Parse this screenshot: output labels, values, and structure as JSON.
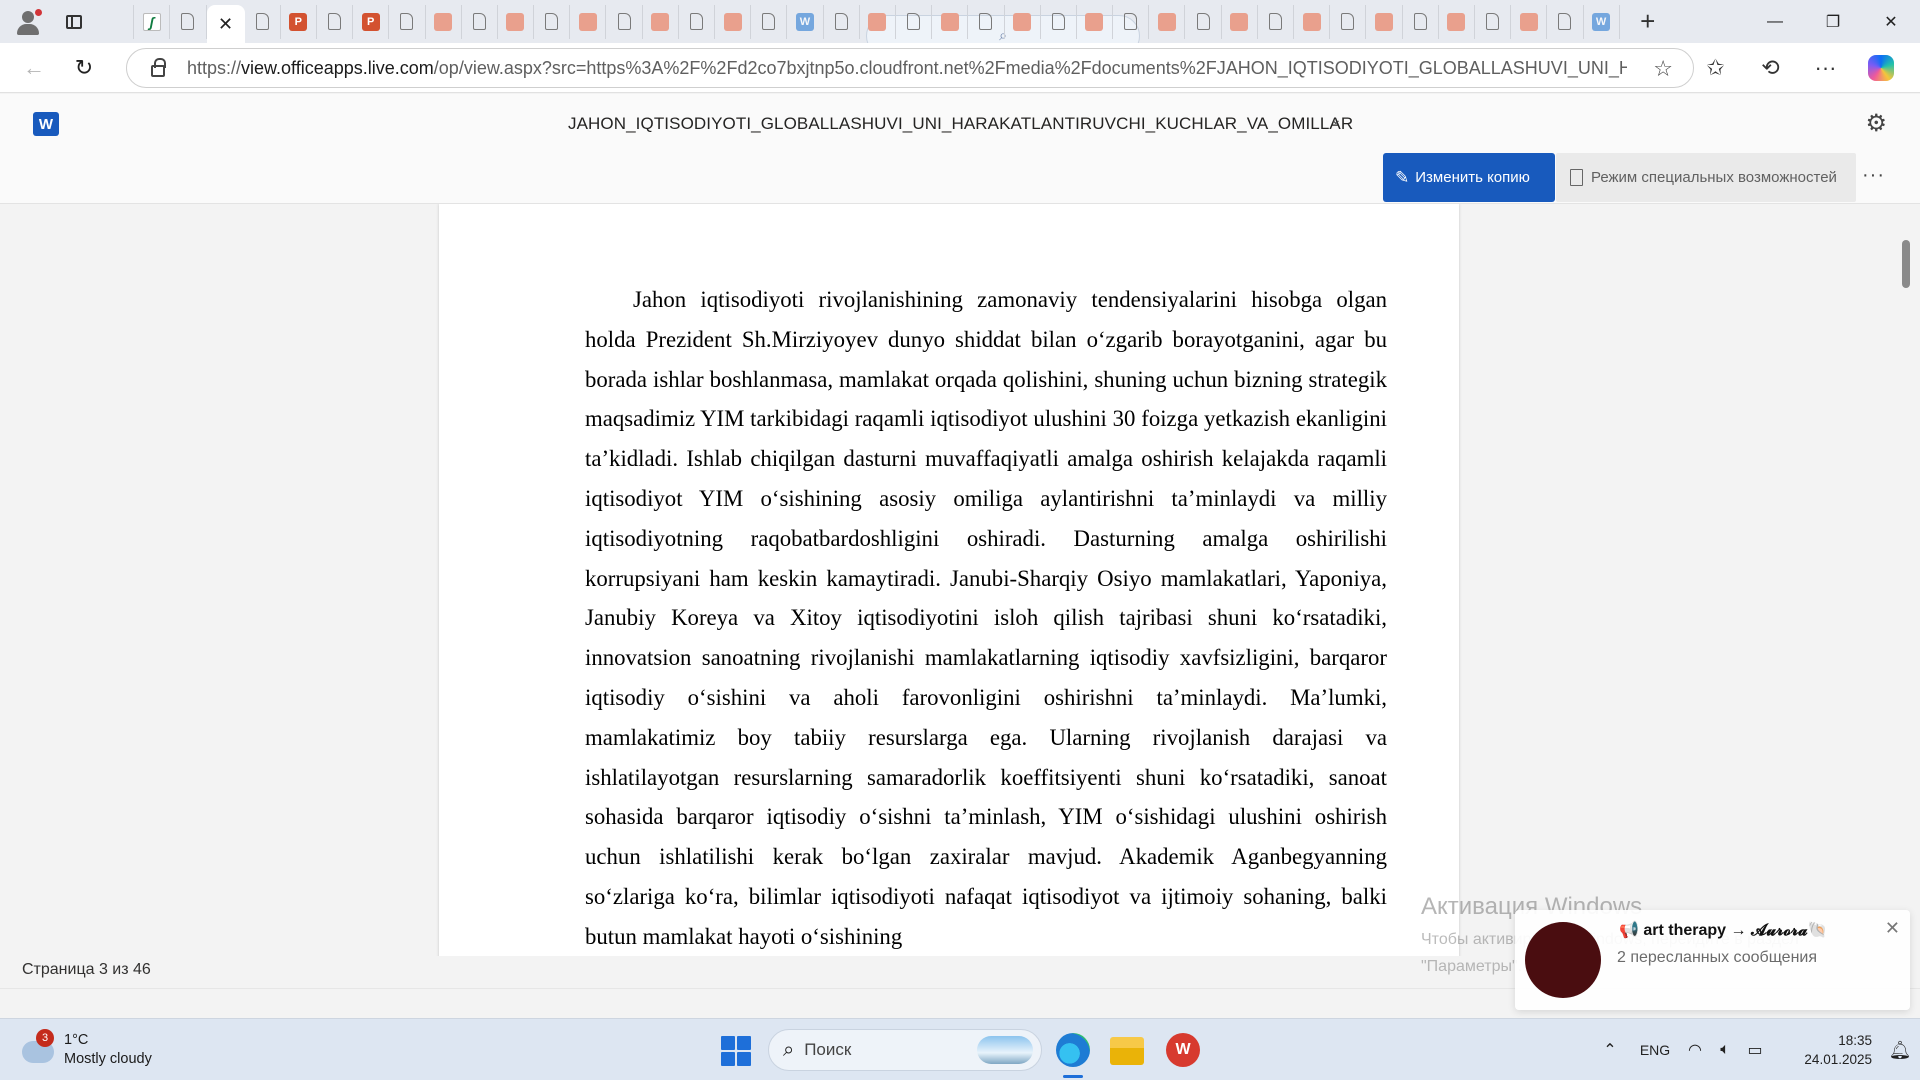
{
  "browser": {
    "tabs": [
      {
        "icon": "search-icon"
      },
      {
        "icon": "sheets-icon"
      },
      {
        "icon": "document-icon"
      },
      {
        "icon": "close-icon",
        "active": true
      },
      {
        "icon": "document-icon"
      },
      {
        "icon": "powerpoint-icon"
      },
      {
        "icon": "document-icon"
      },
      {
        "icon": "powerpoint-icon"
      },
      {
        "icon": "document-icon"
      },
      {
        "icon": "powerpoint-faded-icon"
      },
      {
        "icon": "document-icon"
      },
      {
        "icon": "powerpoint-faded-icon"
      },
      {
        "icon": "document-icon"
      },
      {
        "icon": "powerpoint-faded-icon"
      },
      {
        "icon": "document-icon"
      },
      {
        "icon": "powerpoint-faded-icon"
      },
      {
        "icon": "document-icon"
      },
      {
        "icon": "powerpoint-faded-icon"
      },
      {
        "icon": "document-icon"
      },
      {
        "icon": "word-icon"
      },
      {
        "icon": "document-icon"
      },
      {
        "icon": "powerpoint-faded-icon"
      },
      {
        "icon": "document-icon"
      },
      {
        "icon": "powerpoint-faded-icon"
      },
      {
        "icon": "document-icon"
      },
      {
        "icon": "powerpoint-faded-icon"
      },
      {
        "icon": "document-icon"
      },
      {
        "icon": "powerpoint-faded-icon"
      },
      {
        "icon": "document-icon"
      },
      {
        "icon": "powerpoint-faded-icon"
      },
      {
        "icon": "document-icon"
      },
      {
        "icon": "powerpoint-faded-icon"
      },
      {
        "icon": "document-icon"
      },
      {
        "icon": "powerpoint-faded-icon"
      },
      {
        "icon": "document-icon"
      },
      {
        "icon": "powerpoint-faded-icon"
      },
      {
        "icon": "document-icon"
      },
      {
        "icon": "powerpoint-faded-icon"
      },
      {
        "icon": "document-icon"
      },
      {
        "icon": "powerpoint-faded-icon"
      },
      {
        "icon": "document-icon"
      },
      {
        "icon": "word-icon"
      }
    ],
    "url_host": "https://view.officeapps.live.com",
    "url_path": "/op/view.aspx?src=https%3A%2F%2Fd2co7bxjtnp5o.cloudfront.net%2Fmedia%2Fdocuments%2FJAHON_IQTISODIYOTI_GLOBALLASHUVI_UNI_HARAKATL...",
    "url_host_display": "view.officeapps.live.com"
  },
  "word": {
    "logo_letter": "W",
    "title": "JAHON_IQTISODIYOTI_GLOBALLASHUVI_UNI_HARAKATLANTIRUVCHI_KUCHLAR_VA_OMILLAR",
    "edit_copy_label": "Изменить копию",
    "accessibility_label": "Режим специальных возможностей",
    "paragraph": "Jahon iqtisodiyoti rivojlanishining zamonaviy tendensiyalarini hisobga olgan holda Prezident Sh.Mirziyoyev dunyo shiddat bilan o‘zgarib borayotganini, agar bu borada ishlar boshlanmasa, mamlakat orqada qolishini, shuning uchun bizning strategik maqsadimiz YIM tarkibidagi raqamli iqtisodiyot ulushini 30 foizga yetkazish ekanligini ta’kidladi. Ishlab chiqilgan dasturni muvaffaqiyatli amalga oshirish kelajakda raqamli iqtisodiyot YIM o‘sishining asosiy omiliga aylantirishni ta’minlaydi va milliy iqtisodiyotning raqobatbardoshligini oshiradi. Dasturning amalga oshirilishi korrupsiyani ham keskin kamaytiradi. Janubi-Sharqiy Osiyo mamlakatlari, Yaponiya, Janubiy Koreya va Xitoy iqtisodiyotini isloh qilish tajribasi shuni ko‘rsatadiki, innovatsion sanoatning rivojlanishi mamlakatlarning iqtisodiy xavfsizligini, barqaror iqtisodiy o‘sishini va aholi farovonligini oshirishni ta’minlaydi. Ma’lumki, mamlakatimiz boy tabiiy resurslarga ega. Ularning rivojlanish darajasi va ishlatilayotgan resurslarning samaradorlik koeffitsiyenti shuni ko‘rsatadiki, sanoat sohasida barqaror iqtisodiy o‘sishni ta’minlash, YIM o‘sishidagi ulushini oshirish uchun ishlatilishi kerak bo‘lgan zaxiralar mavjud. Akademik Aganbegyanning so‘zlariga ko‘ra, bilimlar iqtisodiyoti nafaqat iqtisodiyot va ijtimoiy sohaning, balki butun mamlakat hayoti o‘sishining",
    "page_status": "Страница 3 из 46"
  },
  "watermark": {
    "line1": "Активация Windows",
    "line2": "Чтобы активировать Windows, перейдите в раздел",
    "line3": "\"Параметры\"."
  },
  "toast": {
    "title": "📢 art therapy → 𝓐𝓾𝓻𝓸𝓻𝓪🐚",
    "subtitle": "2 пересланных сообщения"
  },
  "taskbar": {
    "weather_badge": "3",
    "temperature": "1°C",
    "condition": "Mostly cloudy",
    "search_placeholder": "Поиск",
    "wps_letter": "W",
    "language": "ENG",
    "time": "18:35",
    "date": "24.01.2025"
  }
}
